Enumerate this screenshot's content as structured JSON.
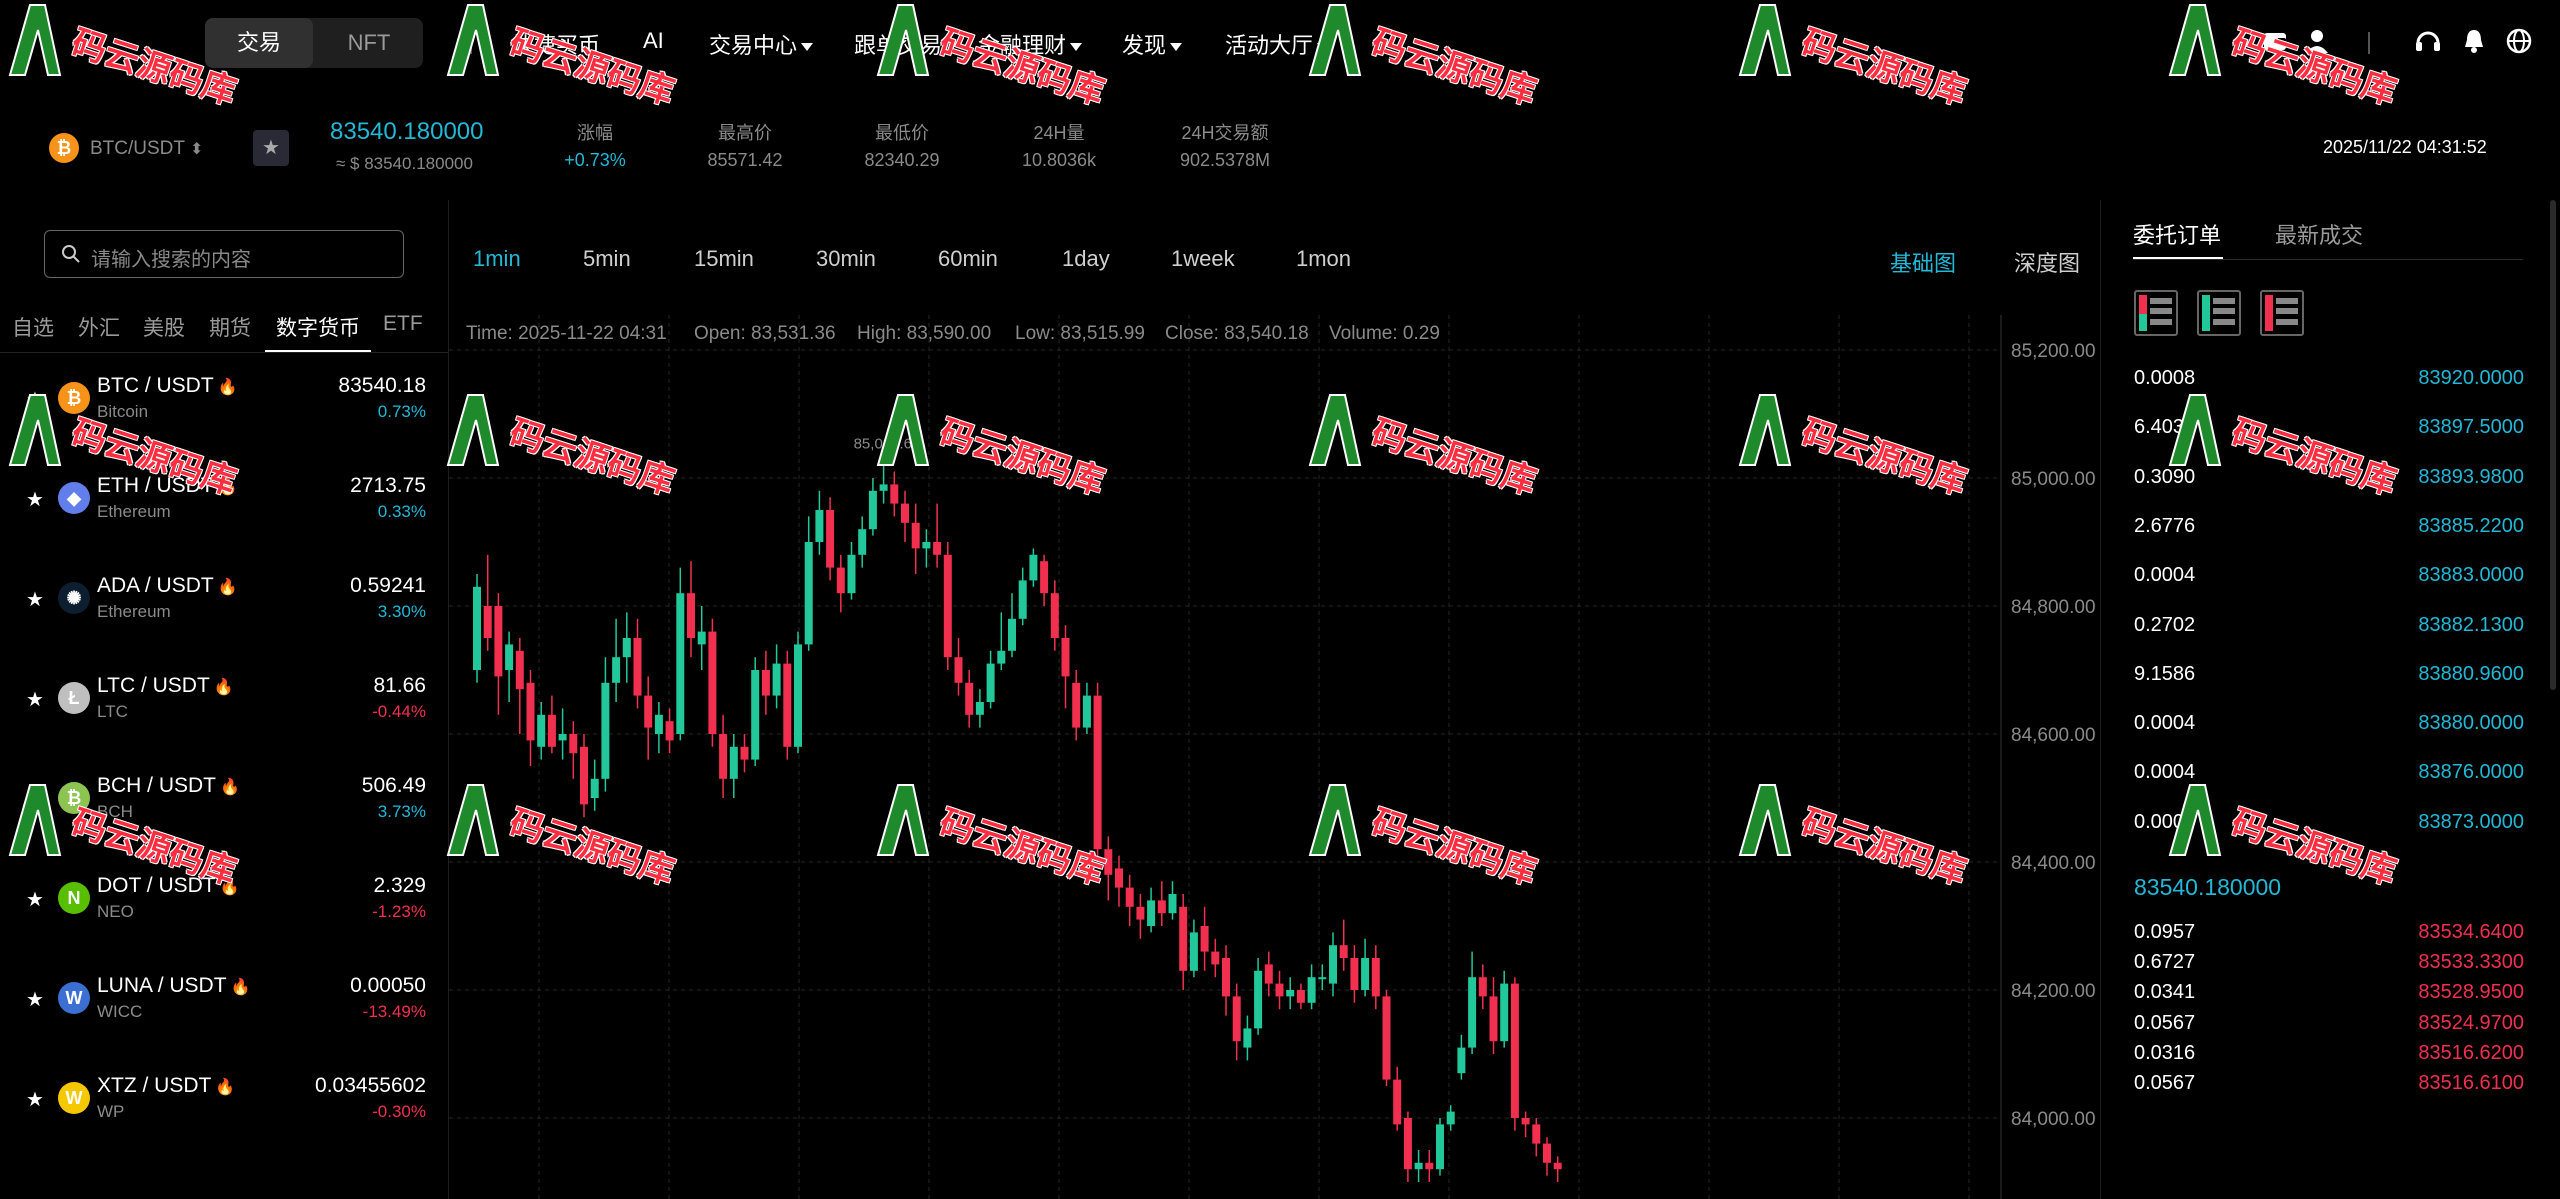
{
  "topnav": {
    "seg_trade": "交易",
    "seg_nft": "NFT",
    "items": [
      "快捷买币",
      "AI",
      "交易中心",
      "跟单交易",
      "金融理财",
      "发现",
      "活动大厅"
    ]
  },
  "ticker": {
    "pair": "BTC/USDT",
    "last_price": "83540.180000",
    "approx": "≈ $ 83540.180000",
    "stats": [
      {
        "label": "涨幅",
        "value": "+0.73%"
      },
      {
        "label": "最高价",
        "value": "85571.42"
      },
      {
        "label": "最低价",
        "value": "82340.29"
      },
      {
        "label": "24H量",
        "value": "10.8036k"
      },
      {
        "label": "24H交易额",
        "value": "902.5378M"
      }
    ],
    "datetime": "2025/11/22 04:31:52"
  },
  "sidebar": {
    "search_placeholder": "请输入搜索的内容",
    "categories": [
      "自选",
      "外汇",
      "美股",
      "期货",
      "数字货币",
      "ETF"
    ],
    "coins": [
      {
        "pair": "BTC / USDT",
        "sub": "Bitcoin",
        "price": "83540.18",
        "change": "0.73%",
        "color": "#f7931a",
        "glyph": "₿"
      },
      {
        "pair": "ETH / USDT",
        "sub": "Ethereum",
        "price": "2713.75",
        "change": "0.33%",
        "color": "#627eea",
        "glyph": "◆"
      },
      {
        "pair": "ADA / USDT",
        "sub": "Ethereum",
        "price": "0.59241",
        "change": "3.30%",
        "color": "#0d1e30",
        "glyph": "✺"
      },
      {
        "pair": "LTC / USDT",
        "sub": "LTC",
        "price": "81.66",
        "change": "-0.44%",
        "color": "#bfbfbf",
        "glyph": "Ł"
      },
      {
        "pair": "BCH / USDT",
        "sub": "BCH",
        "price": "506.49",
        "change": "3.73%",
        "color": "#8dc351",
        "glyph": "₿"
      },
      {
        "pair": "DOT / USDT",
        "sub": "NEO",
        "price": "2.329",
        "change": "-1.23%",
        "color": "#58bf00",
        "glyph": "N"
      },
      {
        "pair": "LUNA / USDT",
        "sub": "WICC",
        "price": "0.00050",
        "change": "-13.49%",
        "color": "#3b6fd1",
        "glyph": "W"
      },
      {
        "pair": "XTZ / USDT",
        "sub": "WP",
        "price": "0.03455602",
        "change": "-0.30%",
        "color": "#f5c800",
        "glyph": "W"
      }
    ]
  },
  "chart": {
    "intervals": [
      "1min",
      "5min",
      "15min",
      "30min",
      "60min",
      "1day",
      "1week",
      "1mon"
    ],
    "views": [
      "基础图",
      "深度图"
    ],
    "ohlc": {
      "time": "Time: 2025-11-22 04:31",
      "open": "Open: 83,531.36",
      "high": "High: 83,590.00",
      "low": "Low: 83,515.99",
      "close": "Close: 83,540.18",
      "volume": "Volume: 0.29"
    },
    "peak_label": "85,024.61",
    "y_ticks": [
      "85,200.00",
      "85,000.00",
      "84,800.00",
      "84,600.00",
      "84,400.00",
      "84,200.00",
      "84,000.00"
    ]
  },
  "chart_data": {
    "type": "candlestick",
    "ylim": [
      83900,
      85200
    ],
    "y_ticks": [
      85200,
      85000,
      84800,
      84600,
      84400,
      84200,
      84000
    ],
    "candles": [
      {
        "o": 84700,
        "c": 84830,
        "h": 84850,
        "l": 84680
      },
      {
        "o": 84800,
        "c": 84750,
        "h": 84880,
        "l": 84730
      },
      {
        "o": 84800,
        "c": 84690,
        "h": 84820,
        "l": 84630
      },
      {
        "o": 84700,
        "c": 84740,
        "h": 84760,
        "l": 84650
      },
      {
        "o": 84730,
        "c": 84670,
        "h": 84750,
        "l": 84600
      },
      {
        "o": 84680,
        "c": 84590,
        "h": 84700,
        "l": 84550
      },
      {
        "o": 84580,
        "c": 84630,
        "h": 84650,
        "l": 84560
      },
      {
        "o": 84630,
        "c": 84580,
        "h": 84660,
        "l": 84570
      },
      {
        "o": 84590,
        "c": 84600,
        "h": 84640,
        "l": 84560
      },
      {
        "o": 84600,
        "c": 84570,
        "h": 84620,
        "l": 84530
      },
      {
        "o": 84580,
        "c": 84490,
        "h": 84600,
        "l": 84470
      },
      {
        "o": 84500,
        "c": 84530,
        "h": 84560,
        "l": 84480
      },
      {
        "o": 84530,
        "c": 84680,
        "h": 84720,
        "l": 84510
      },
      {
        "o": 84680,
        "c": 84720,
        "h": 84780,
        "l": 84650
      },
      {
        "o": 84720,
        "c": 84750,
        "h": 84790,
        "l": 84680
      },
      {
        "o": 84750,
        "c": 84660,
        "h": 84780,
        "l": 84640
      },
      {
        "o": 84660,
        "c": 84610,
        "h": 84690,
        "l": 84560
      },
      {
        "o": 84600,
        "c": 84630,
        "h": 84650,
        "l": 84570
      },
      {
        "o": 84620,
        "c": 84590,
        "h": 84640,
        "l": 84570
      },
      {
        "o": 84600,
        "c": 84820,
        "h": 84860,
        "l": 84590
      },
      {
        "o": 84820,
        "c": 84750,
        "h": 84870,
        "l": 84720
      },
      {
        "o": 84740,
        "c": 84760,
        "h": 84800,
        "l": 84700
      },
      {
        "o": 84760,
        "c": 84600,
        "h": 84780,
        "l": 84580
      },
      {
        "o": 84600,
        "c": 84530,
        "h": 84630,
        "l": 84500
      },
      {
        "o": 84530,
        "c": 84580,
        "h": 84600,
        "l": 84500
      },
      {
        "o": 84580,
        "c": 84560,
        "h": 84600,
        "l": 84540
      },
      {
        "o": 84560,
        "c": 84700,
        "h": 84720,
        "l": 84550
      },
      {
        "o": 84700,
        "c": 84660,
        "h": 84730,
        "l": 84630
      },
      {
        "o": 84660,
        "c": 84710,
        "h": 84740,
        "l": 84640
      },
      {
        "o": 84710,
        "c": 84580,
        "h": 84730,
        "l": 84560
      },
      {
        "o": 84580,
        "c": 84740,
        "h": 84760,
        "l": 84570
      },
      {
        "o": 84740,
        "c": 84900,
        "h": 84940,
        "l": 84730
      },
      {
        "o": 84900,
        "c": 84950,
        "h": 84980,
        "l": 84880
      },
      {
        "o": 84950,
        "c": 84860,
        "h": 84970,
        "l": 84840
      },
      {
        "o": 84860,
        "c": 84820,
        "h": 84880,
        "l": 84790
      },
      {
        "o": 84820,
        "c": 84880,
        "h": 84900,
        "l": 84810
      },
      {
        "o": 84880,
        "c": 84920,
        "h": 84940,
        "l": 84860
      },
      {
        "o": 84920,
        "c": 84980,
        "h": 85000,
        "l": 84910
      },
      {
        "o": 84980,
        "c": 84990,
        "h": 85024,
        "l": 84960
      },
      {
        "o": 84990,
        "c": 84960,
        "h": 85010,
        "l": 84940
      },
      {
        "o": 84960,
        "c": 84930,
        "h": 84980,
        "l": 84900
      },
      {
        "o": 84930,
        "c": 84890,
        "h": 84960,
        "l": 84850
      },
      {
        "o": 84890,
        "c": 84900,
        "h": 84920,
        "l": 84860
      },
      {
        "o": 84900,
        "c": 84880,
        "h": 84960,
        "l": 84860
      },
      {
        "o": 84880,
        "c": 84720,
        "h": 84900,
        "l": 84700
      },
      {
        "o": 84720,
        "c": 84680,
        "h": 84750,
        "l": 84660
      },
      {
        "o": 84680,
        "c": 84630,
        "h": 84700,
        "l": 84610
      },
      {
        "o": 84630,
        "c": 84650,
        "h": 84670,
        "l": 84610
      },
      {
        "o": 84650,
        "c": 84710,
        "h": 84730,
        "l": 84640
      },
      {
        "o": 84710,
        "c": 84730,
        "h": 84790,
        "l": 84700
      },
      {
        "o": 84730,
        "c": 84780,
        "h": 84820,
        "l": 84720
      },
      {
        "o": 84780,
        "c": 84840,
        "h": 84860,
        "l": 84770
      },
      {
        "o": 84840,
        "c": 84880,
        "h": 84890,
        "l": 84830
      },
      {
        "o": 84870,
        "c": 84820,
        "h": 84880,
        "l": 84800
      },
      {
        "o": 84820,
        "c": 84750,
        "h": 84840,
        "l": 84730
      },
      {
        "o": 84750,
        "c": 84690,
        "h": 84770,
        "l": 84640
      },
      {
        "o": 84680,
        "c": 84610,
        "h": 84700,
        "l": 84590
      },
      {
        "o": 84610,
        "c": 84660,
        "h": 84680,
        "l": 84600
      },
      {
        "o": 84660,
        "c": 84420,
        "h": 84680,
        "l": 84400
      },
      {
        "o": 84420,
        "c": 84380,
        "h": 84440,
        "l": 84340
      },
      {
        "o": 84390,
        "c": 84360,
        "h": 84410,
        "l": 84330
      },
      {
        "o": 84360,
        "c": 84330,
        "h": 84380,
        "l": 84300
      },
      {
        "o": 84330,
        "c": 84310,
        "h": 84350,
        "l": 84280
      },
      {
        "o": 84300,
        "c": 84340,
        "h": 84360,
        "l": 84290
      },
      {
        "o": 84340,
        "c": 84320,
        "h": 84370,
        "l": 84300
      },
      {
        "o": 84320,
        "c": 84350,
        "h": 84370,
        "l": 84310
      },
      {
        "o": 84330,
        "c": 84230,
        "h": 84350,
        "l": 84200
      },
      {
        "o": 84230,
        "c": 84290,
        "h": 84310,
        "l": 84220
      },
      {
        "o": 84300,
        "c": 84260,
        "h": 84330,
        "l": 84230
      },
      {
        "o": 84260,
        "c": 84240,
        "h": 84280,
        "l": 84220
      },
      {
        "o": 84250,
        "c": 84190,
        "h": 84270,
        "l": 84160
      },
      {
        "o": 84190,
        "c": 84120,
        "h": 84210,
        "l": 84090
      },
      {
        "o": 84110,
        "c": 84140,
        "h": 84160,
        "l": 84090
      },
      {
        "o": 84140,
        "c": 84230,
        "h": 84250,
        "l": 84130
      },
      {
        "o": 84240,
        "c": 84210,
        "h": 84260,
        "l": 84190
      },
      {
        "o": 84210,
        "c": 84190,
        "h": 84230,
        "l": 84170
      },
      {
        "o": 84190,
        "c": 84200,
        "h": 84220,
        "l": 84170
      },
      {
        "o": 84200,
        "c": 84180,
        "h": 84210,
        "l": 84170
      },
      {
        "o": 84180,
        "c": 84220,
        "h": 84240,
        "l": 84170
      },
      {
        "o": 84220,
        "c": 84220,
        "h": 84240,
        "l": 84200
      },
      {
        "o": 84210,
        "c": 84270,
        "h": 84290,
        "l": 84190
      },
      {
        "o": 84270,
        "c": 84250,
        "h": 84310,
        "l": 84230
      },
      {
        "o": 84250,
        "c": 84200,
        "h": 84270,
        "l": 84180
      },
      {
        "o": 84200,
        "c": 84250,
        "h": 84280,
        "l": 84190
      },
      {
        "o": 84250,
        "c": 84190,
        "h": 84270,
        "l": 84170
      },
      {
        "o": 84190,
        "c": 84060,
        "h": 84200,
        "l": 84050
      },
      {
        "o": 84060,
        "c": 83990,
        "h": 84080,
        "l": 83980
      },
      {
        "o": 84000,
        "c": 83920,
        "h": 84010,
        "l": 83900
      },
      {
        "o": 83920,
        "c": 83930,
        "h": 83950,
        "l": 83900
      },
      {
        "o": 83930,
        "c": 83920,
        "h": 83950,
        "l": 83900
      },
      {
        "o": 83920,
        "c": 83990,
        "h": 84000,
        "l": 83910
      },
      {
        "o": 83990,
        "c": 84010,
        "h": 84020,
        "l": 83980
      },
      {
        "o": 84070,
        "c": 84110,
        "h": 84130,
        "l": 84060
      },
      {
        "o": 84110,
        "c": 84220,
        "h": 84260,
        "l": 84100
      },
      {
        "o": 84220,
        "c": 84190,
        "h": 84240,
        "l": 84170
      },
      {
        "o": 84190,
        "c": 84120,
        "h": 84220,
        "l": 84100
      },
      {
        "o": 84120,
        "c": 84210,
        "h": 84230,
        "l": 84110
      },
      {
        "o": 84210,
        "c": 84000,
        "h": 84220,
        "l": 83980
      },
      {
        "o": 84000,
        "c": 83990,
        "h": 84010,
        "l": 83970
      },
      {
        "o": 83990,
        "c": 83960,
        "h": 84000,
        "l": 83940
      },
      {
        "o": 83960,
        "c": 83930,
        "h": 83970,
        "l": 83910
      },
      {
        "o": 83930,
        "c": 83920,
        "h": 83940,
        "l": 83900
      }
    ]
  },
  "orderbook": {
    "tabs": [
      "委托订单",
      "最新成交"
    ],
    "asks": [
      {
        "q": "0.0008",
        "p": "83920.0000"
      },
      {
        "q": "6.4032",
        "p": "83897.5000"
      },
      {
        "q": "0.3090",
        "p": "83893.9800"
      },
      {
        "q": "2.6776",
        "p": "83885.2200"
      },
      {
        "q": "0.0004",
        "p": "83883.0000"
      },
      {
        "q": "0.2702",
        "p": "83882.1300"
      },
      {
        "q": "9.1586",
        "p": "83880.9600"
      },
      {
        "q": "0.0004",
        "p": "83880.0000"
      },
      {
        "q": "0.0004",
        "p": "83876.0000"
      },
      {
        "q": "0.0004",
        "p": "83873.0000"
      }
    ],
    "mid": "83540.180000",
    "bids": [
      {
        "q": "0.0957",
        "p": "83534.6400"
      },
      {
        "q": "0.6727",
        "p": "83533.3300"
      },
      {
        "q": "0.0341",
        "p": "83528.9500"
      },
      {
        "q": "0.0567",
        "p": "83524.9700"
      },
      {
        "q": "0.0316",
        "p": "83516.6200"
      },
      {
        "q": "0.0567",
        "p": "83516.6100"
      }
    ]
  },
  "colors": {
    "up": "#22c79a",
    "down": "#f0304e",
    "accent": "#22b8d6",
    "grid": "#262626"
  },
  "watermark": "码云源码库"
}
